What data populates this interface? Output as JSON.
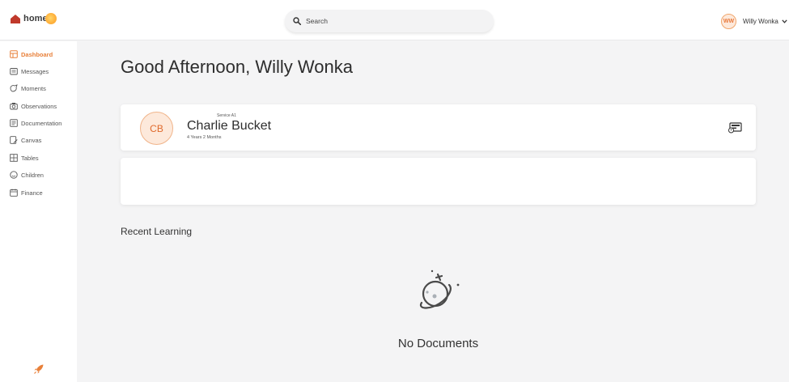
{
  "app": {
    "logo_text": "home"
  },
  "search": {
    "placeholder": "Search"
  },
  "user": {
    "initials": "WW",
    "name": "Willy Wonka"
  },
  "sidebar": {
    "items": [
      {
        "label": "Dashboard",
        "icon": "dashboard-icon",
        "active": true
      },
      {
        "label": "Messages",
        "icon": "messages-icon"
      },
      {
        "label": "Moments",
        "icon": "moments-icon"
      },
      {
        "label": "Observations",
        "icon": "observations-icon"
      },
      {
        "label": "Documentation",
        "icon": "documentation-icon"
      },
      {
        "label": "Canvas",
        "icon": "canvas-icon"
      },
      {
        "label": "Tables",
        "icon": "tables-icon"
      },
      {
        "label": "Children",
        "icon": "children-icon"
      },
      {
        "label": "Finance",
        "icon": "finance-icon"
      }
    ]
  },
  "main": {
    "greeting": "Good Afternoon, Willy Wonka",
    "child": {
      "initials": "CB",
      "service": "Service A1",
      "name": "Charlie Bucket",
      "age": "4 Years 2 Months"
    },
    "recent_learning_title": "Recent Learning",
    "empty_state": "No Documents"
  },
  "colors": {
    "accent": "#e8803a",
    "background": "#f4f4f5",
    "card": "#ffffff"
  }
}
